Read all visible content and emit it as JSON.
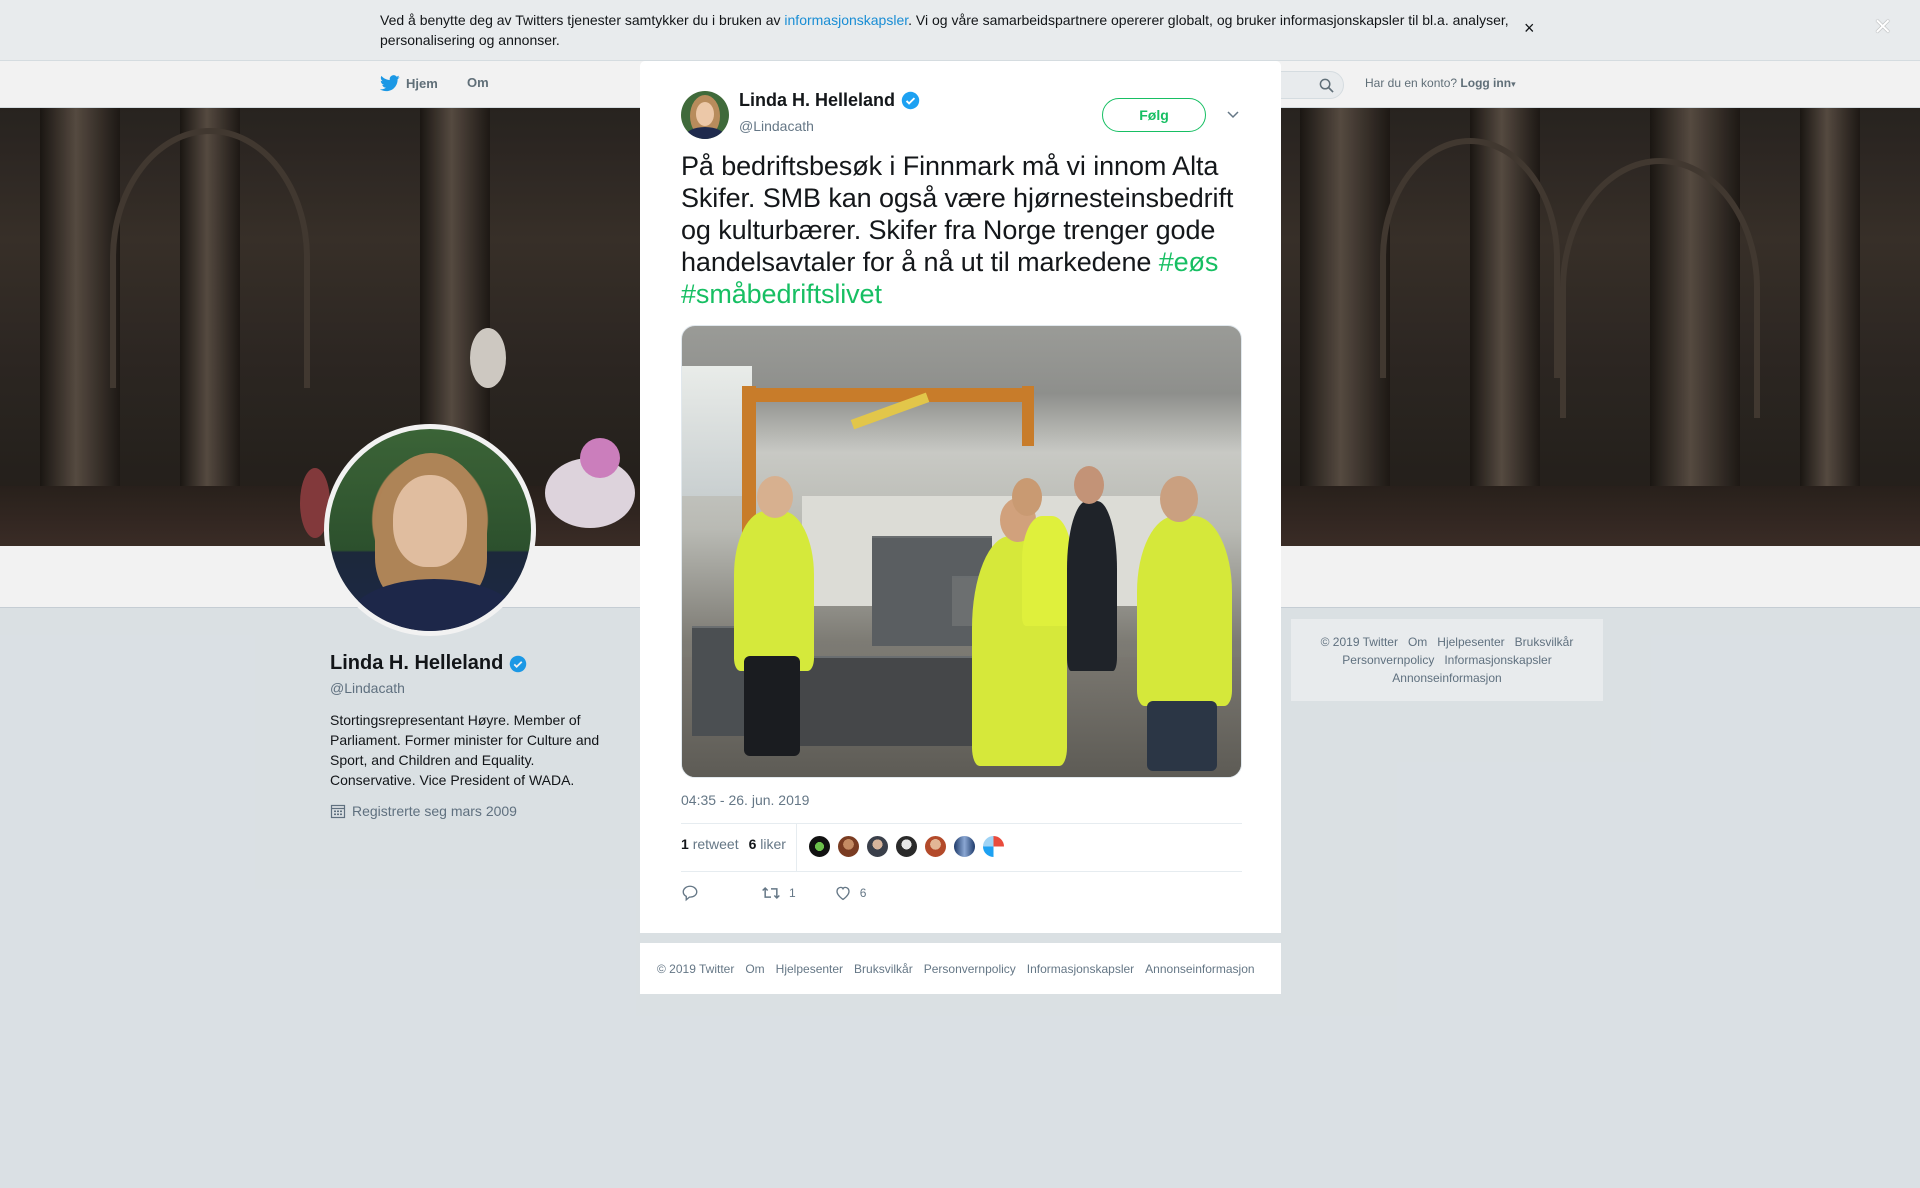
{
  "cookie_bar": {
    "text_before": "Ved å benytte deg av Twitters tjenester samtykker du i bruken av ",
    "link": "informasjonskapsler",
    "text_after": ". Vi og våre samarbeidspartnere opererer globalt, og bruker informasjonskapsler til bl.a. analyser, personalisering og annonser.",
    "close": "×"
  },
  "nav": {
    "home": "Hjem",
    "about": "Om",
    "account_prompt": "Har du en konto?",
    "login": "Logg inn"
  },
  "profile": {
    "name": "Linda H. Helleland",
    "handle": "@Lindacath",
    "bio": "Stortingsrepresentant Høyre. Member of Parliament. Former minister for Culture and Sport, and Children and Equality. Conservative. Vice President of WADA.",
    "joined": "Registrerte seg mars 2009"
  },
  "side_footer": {
    "items": [
      "© 2019 Twitter",
      "Om",
      "Hjelpesenter",
      "Bruksvilkår",
      "Personvernpolicy",
      "Informasjonskapsler",
      "Annonseinformasjon"
    ]
  },
  "modal": {
    "close": "×",
    "tweet": {
      "name": "Linda H. Helleland",
      "handle": "@Lindacath",
      "follow": "Følg",
      "text": "På bedriftsbesøk i Finnmark må vi innom Alta Skifer. SMB kan også være hjørnesteinsbedrift og kulturbærer. Skifer fra Norge trenger gode handelsavtaler for å nå ut til markedene",
      "hashtags": [
        "#eøs",
        "#småbedriftslivet"
      ],
      "timestamp": "04:35 - 26. jun. 2019",
      "retweets_count": "1",
      "retweets_label": "retweet",
      "likes_count": "6",
      "likes_label": "liker",
      "action_retweets": "1",
      "action_likes": "6"
    }
  },
  "modal_footer": {
    "items": [
      "© 2019 Twitter",
      "Om",
      "Hjelpesenter",
      "Bruksvilkår",
      "Personvernpolicy",
      "Informasjonskapsler",
      "Annonseinformasjon"
    ]
  },
  "colors": {
    "accent": "#17bf63",
    "link": "#1b95e0",
    "verified": "#1da1f2"
  }
}
